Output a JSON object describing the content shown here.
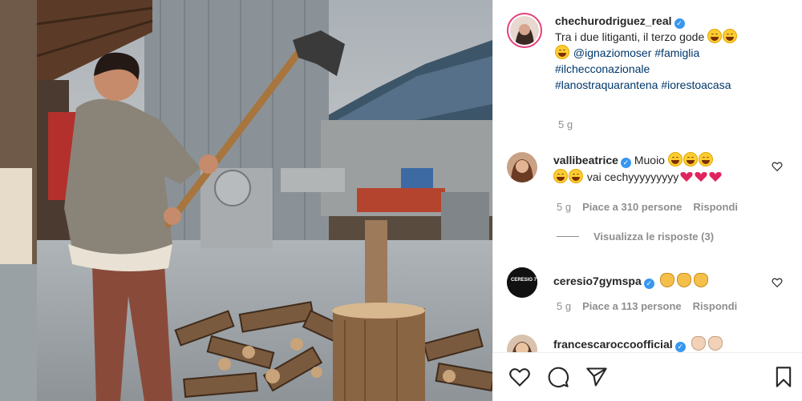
{
  "post": {
    "username": "chechurodriguez_real",
    "caption_line1": "Tra i due litiganti, il terzo gode",
    "mention": "@ignaziomoser",
    "tag_famiglia": "#famiglia",
    "tag_ilchecconazionale": "#ilchecconazionale",
    "tag_lanostraquarantena": "#lanostraquarantena",
    "tag_iorestoacasa": "#iorestoacasa",
    "time": "5 g"
  },
  "comments": [
    {
      "username": "vallibeatrice",
      "text1": "Muoio",
      "text2": "vai cechyyyyyyyyy",
      "time": "5 g",
      "likes": "Piace a 310 persone",
      "reply": "Rispondi"
    },
    {
      "username": "ceresio7gymspa",
      "time": "5 g",
      "likes": "Piace a 113 persone",
      "reply": "Rispondi"
    },
    {
      "username": "francescaroccoofficial"
    }
  ],
  "view_replies": "Visualizza le risposte (3)",
  "avatar_ceresio_text": "CERESIO 7",
  "icons": {
    "like": "heart-icon",
    "comment": "comment-icon",
    "share": "share-icon",
    "save": "bookmark-icon"
  },
  "colors": {
    "hashtag": "#00376b",
    "verified": "#3897f0",
    "muted": "#8e8e8e",
    "story_ring": "#e53f7a"
  }
}
